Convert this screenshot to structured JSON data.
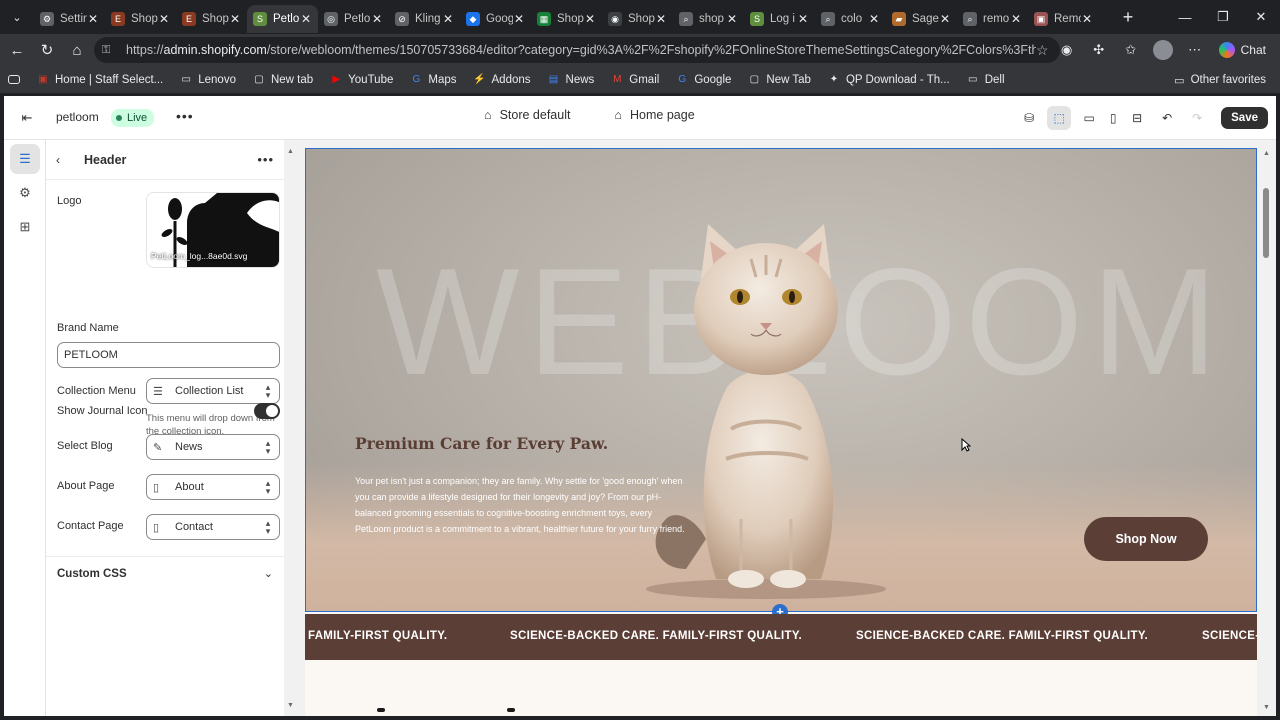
{
  "browser": {
    "tabs": [
      {
        "title": "Settin",
        "color": "#5f6368",
        "glyph": "⚙",
        "active": false
      },
      {
        "title": "Shop",
        "color": "#8a3a20",
        "glyph": "E",
        "active": false
      },
      {
        "title": "Shop",
        "color": "#8a3a20",
        "glyph": "E",
        "active": false
      },
      {
        "title": "Petlo",
        "color": "#5e8e3e",
        "glyph": "S",
        "active": true
      },
      {
        "title": "Petlo",
        "color": "#5f6368",
        "glyph": "◎",
        "active": false
      },
      {
        "title": "Kling",
        "color": "#5f6368",
        "glyph": "⊘",
        "active": false
      },
      {
        "title": "Goog",
        "color": "#1a73e8",
        "glyph": "◆",
        "active": false
      },
      {
        "title": "Shop",
        "color": "#188038",
        "glyph": "▦",
        "active": false
      },
      {
        "title": "Shop",
        "color": "#3c4043",
        "glyph": "◉",
        "active": false
      },
      {
        "title": "shop",
        "color": "#5f6368",
        "glyph": "⌕",
        "active": false
      },
      {
        "title": "Log i",
        "color": "#5e8e3e",
        "glyph": "S",
        "active": false
      },
      {
        "title": "colo",
        "color": "#5f6368",
        "glyph": "⌕",
        "active": false
      },
      {
        "title": "Sage",
        "color": "#b06a2c",
        "glyph": "▰",
        "active": false
      },
      {
        "title": "remo",
        "color": "#5f6368",
        "glyph": "⌕",
        "active": false
      },
      {
        "title": "Remo",
        "color": "#9a5252",
        "glyph": "▣",
        "active": false
      }
    ],
    "url_domain": "admin.shopify.com",
    "url_rest": "/store/webloom/themes/150705733684/editor?category=gid%3A%2F%2Fshopify%2FOnlineStoreThemeSettingsCategory%2FColors%3Ftheme_id%...",
    "url_prefix": "https://",
    "chat_label": "Chat",
    "bookmarks": [
      {
        "label": "Home | Staff Select...",
        "icon": "home-favicon-icon",
        "color": "#c0392b"
      },
      {
        "label": "Lenovo",
        "icon": "folder-icon",
        "color": "#e8eaed"
      },
      {
        "label": "New tab",
        "icon": "page-icon",
        "color": "#e8eaed"
      },
      {
        "label": "YouTube",
        "icon": "youtube-icon",
        "color": "#ff0000"
      },
      {
        "label": "Maps",
        "icon": "google-icon",
        "color": "#4285f4"
      },
      {
        "label": "Addons",
        "icon": "addons-icon",
        "color": "#3b5ccc"
      },
      {
        "label": "News",
        "icon": "news-icon",
        "color": "#4285f4"
      },
      {
        "label": "Gmail",
        "icon": "gmail-icon",
        "color": "#ea4335"
      },
      {
        "label": "Google",
        "icon": "google-icon",
        "color": "#4285f4"
      },
      {
        "label": "New Tab",
        "icon": "page-icon",
        "color": "#e8eaed"
      },
      {
        "label": "QP Download - Th...",
        "icon": "qp-icon",
        "color": "#e8eaed"
      },
      {
        "label": "Dell",
        "icon": "folder-icon",
        "color": "#e8eaed"
      }
    ],
    "other_favorites": "Other favorites"
  },
  "editor": {
    "store_name": "petloom",
    "status": "Live",
    "template_label": "Store default",
    "page_label": "Home page",
    "save_label": "Save"
  },
  "panel": {
    "title": "Header",
    "logo_label": "Logo",
    "logo_file": "PetLoom_log...8ae0d.svg",
    "brand_label": "Brand Name",
    "brand_value": "PETLOOM",
    "collection_label": "Collection Menu",
    "collection_value": "Collection List",
    "collection_hint": "This menu will drop down from the collection icon.",
    "journal_label": "Show Journal Icon",
    "journal_on": true,
    "blog_label": "Select Blog",
    "blog_value": "News",
    "about_label": "About Page",
    "about_value": "About",
    "contact_label": "Contact Page",
    "contact_value": "Contact",
    "custom_css_label": "Custom CSS"
  },
  "preview": {
    "watermark": "WEBLOOM",
    "hero_title": "Premium Care for Every Paw.",
    "hero_body": "Your pet isn't just a companion; they are family. Why settle for 'good enough' when you can provide a lifestyle designed for their longevity and joy? From our pH-balanced grooming essentials to cognitive-boosting enrichment toys, every PetLoom product is a commitment to a vibrant, healthier future for your furry friend.",
    "cta_label": "Shop Now",
    "marquee": [
      "FAMILY-FIRST QUALITY.",
      "SCIENCE-BACKED CARE. FAMILY-FIRST QUALITY.",
      "SCIENCE-BACKED CARE. FAMILY-FIRST QUALITY.",
      "SCIENCE-"
    ],
    "colors": {
      "brand_brown": "#5b3e35",
      "hero_title": "#5a3d33",
      "selection": "#2c6ecb"
    }
  }
}
